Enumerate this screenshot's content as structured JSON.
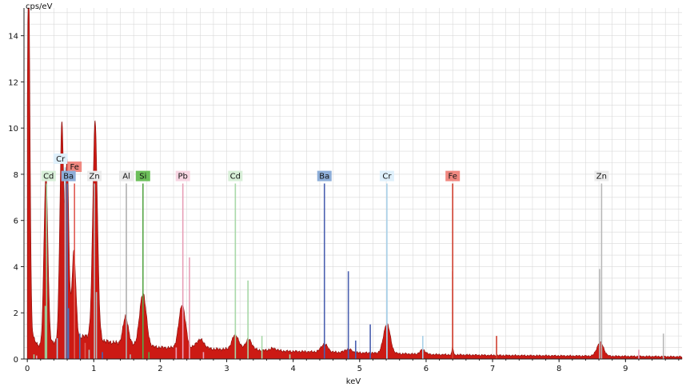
{
  "chart_data": {
    "type": "area",
    "ylabel": "cps/eV",
    "xlabel": "keV",
    "xlim": [
      -0.05,
      9.85
    ],
    "ylim": [
      0,
      15.2
    ],
    "x_ticks": [
      0,
      1,
      2,
      3,
      4,
      5,
      6,
      7,
      8,
      9
    ],
    "y_ticks": [
      0,
      2,
      4,
      6,
      8,
      10,
      12,
      14
    ],
    "grid": true,
    "colors": {
      "spectrum": "#cc1a14",
      "spectrum_edge": "#8a0f0c",
      "grid": "#d9d9d9"
    },
    "spectrum": {
      "background": [
        [
          0.0,
          2.0
        ],
        [
          0.05,
          1.5
        ],
        [
          0.1,
          0.9
        ],
        [
          0.15,
          0.6
        ],
        [
          0.2,
          0.55
        ],
        [
          0.3,
          0.6
        ],
        [
          0.4,
          0.7
        ],
        [
          0.5,
          0.8
        ],
        [
          0.7,
          0.9
        ],
        [
          0.9,
          1.0
        ],
        [
          1.2,
          0.75
        ],
        [
          1.6,
          0.6
        ],
        [
          2.0,
          0.5
        ],
        [
          2.5,
          0.45
        ],
        [
          3.0,
          0.42
        ],
        [
          3.5,
          0.38
        ],
        [
          4.0,
          0.33
        ],
        [
          4.5,
          0.3
        ],
        [
          5.0,
          0.27
        ],
        [
          5.5,
          0.24
        ],
        [
          6.0,
          0.2
        ],
        [
          6.5,
          0.18
        ],
        [
          7.0,
          0.16
        ],
        [
          7.5,
          0.15
        ],
        [
          8.0,
          0.14
        ],
        [
          8.5,
          0.13
        ],
        [
          9.0,
          0.12
        ],
        [
          9.5,
          0.11
        ],
        [
          9.85,
          0.1
        ]
      ],
      "peaks": [
        [
          0.02,
          15.0,
          0.02
        ],
        [
          0.28,
          7.4,
          0.03
        ],
        [
          0.52,
          9.4,
          0.03
        ],
        [
          0.6,
          7.6,
          0.025
        ],
        [
          0.7,
          3.8,
          0.03
        ],
        [
          1.02,
          9.4,
          0.035
        ],
        [
          1.48,
          1.2,
          0.04
        ],
        [
          1.74,
          2.3,
          0.05
        ],
        [
          2.33,
          1.9,
          0.05
        ],
        [
          2.6,
          0.4,
          0.06
        ],
        [
          3.13,
          0.65,
          0.05
        ],
        [
          3.33,
          0.45,
          0.05
        ],
        [
          3.7,
          0.1,
          0.05
        ],
        [
          4.47,
          0.35,
          0.05
        ],
        [
          4.83,
          0.15,
          0.05
        ],
        [
          5.41,
          1.3,
          0.05
        ],
        [
          5.95,
          0.2,
          0.04
        ],
        [
          6.4,
          0.35,
          0.01
        ],
        [
          8.62,
          0.6,
          0.05
        ]
      ]
    },
    "markers": [
      {
        "element": "Cd",
        "x": 0.29,
        "h": 7.6,
        "color": "#9ccf9c"
      },
      {
        "element": "Ba",
        "x": 0.6,
        "h": 7.6,
        "color": "#4a72b8"
      },
      {
        "element": "Fe",
        "x": 0.71,
        "h": 7.6,
        "color": "#e05a52"
      },
      {
        "element": "Zn",
        "x": 1.01,
        "h": 7.6,
        "color": "#b8b8b8"
      },
      {
        "element": "Al",
        "x": 1.49,
        "h": 7.6,
        "color": "#b0b0b0"
      },
      {
        "element": "Si",
        "x": 1.74,
        "h": 7.6,
        "color": "#5aa84a"
      },
      {
        "element": "Pb",
        "x": 2.34,
        "h": 7.6,
        "color": "#e8a0b8"
      },
      {
        "element": "Cd",
        "x": 3.13,
        "h": 7.6,
        "color": "#a8d8a8"
      },
      {
        "element": "Ba",
        "x": 4.47,
        "h": 7.6,
        "color": "#4a60b0"
      },
      {
        "element": "Cr",
        "x": 5.41,
        "h": 7.6,
        "color": "#a8d0e8"
      },
      {
        "element": "Fe",
        "x": 6.4,
        "h": 7.6,
        "color": "#d04030"
      },
      {
        "element": "Zn",
        "x": 8.64,
        "h": 7.6,
        "color": "#b8b8b8"
      },
      {
        "element": "Cr",
        "x": 0.57,
        "h": 8.3,
        "color": "#a8d0e8"
      }
    ],
    "labels": [
      {
        "text": "Cd",
        "x": 0.32,
        "y": 7.7,
        "bg": "#d8efd8"
      },
      {
        "text": "Cr",
        "x": 0.5,
        "y": 8.45,
        "bg": "#dff0fb"
      },
      {
        "text": "Fe",
        "x": 0.71,
        "y": 8.1,
        "bg": "#f08880"
      },
      {
        "text": "Ba",
        "x": 0.62,
        "y": 7.7,
        "bg": "#8eaed8"
      },
      {
        "text": "Zn",
        "x": 1.01,
        "y": 7.7,
        "bg": "#ececec"
      },
      {
        "text": "Al",
        "x": 1.49,
        "y": 7.7,
        "bg": "#e8e8e8"
      },
      {
        "text": "Si",
        "x": 1.74,
        "y": 7.7,
        "bg": "#6cbf5a"
      },
      {
        "text": "Pb",
        "x": 2.34,
        "y": 7.7,
        "bg": "#f7d5e2"
      },
      {
        "text": "Cd",
        "x": 3.13,
        "y": 7.7,
        "bg": "#d8efd8"
      },
      {
        "text": "Ba",
        "x": 4.47,
        "y": 7.7,
        "bg": "#8eaed8"
      },
      {
        "text": "Cr",
        "x": 5.41,
        "y": 7.7,
        "bg": "#dff0fb"
      },
      {
        "text": "Fe",
        "x": 6.4,
        "y": 7.7,
        "bg": "#f08880"
      },
      {
        "text": "Zn",
        "x": 8.64,
        "y": 7.7,
        "bg": "#ececec"
      }
    ],
    "lines": [
      [
        0.1,
        0.2,
        "#9ccf9c"
      ],
      [
        0.14,
        0.15,
        "#e8a0b8"
      ],
      [
        0.27,
        2.3,
        "#9ccf9c"
      ],
      [
        0.45,
        0.9,
        "#a8d0e8"
      ],
      [
        0.62,
        2.2,
        "#4a72b8"
      ],
      [
        0.79,
        1.1,
        "#4a72b8"
      ],
      [
        0.87,
        0.7,
        "#e05a52"
      ],
      [
        0.93,
        0.4,
        "#b8b8b8"
      ],
      [
        1.04,
        2.9,
        "#b8b8b8"
      ],
      [
        1.13,
        0.3,
        "#4a60b0"
      ],
      [
        1.55,
        0.2,
        "#b0b0b0"
      ],
      [
        1.83,
        0.3,
        "#5aa84a"
      ],
      [
        2.24,
        0.5,
        "#e8a0b8"
      ],
      [
        2.44,
        4.4,
        "#e8a0b8"
      ],
      [
        2.65,
        0.3,
        "#e8a0b8"
      ],
      [
        3.32,
        3.4,
        "#a8d8a8"
      ],
      [
        3.53,
        1.0,
        "#a8d8a8"
      ],
      [
        3.95,
        0.2,
        "#a8d8a8"
      ],
      [
        4.83,
        3.8,
        "#4a60b0"
      ],
      [
        4.94,
        0.8,
        "#4a60b0"
      ],
      [
        5.16,
        1.5,
        "#4a60b0"
      ],
      [
        5.41,
        3.8,
        "#a8d0e8"
      ],
      [
        5.95,
        1.0,
        "#a8d0e8"
      ],
      [
        6.4,
        3.8,
        "#d04030"
      ],
      [
        7.06,
        1.0,
        "#d04030"
      ],
      [
        8.61,
        3.9,
        "#b8b8b8"
      ],
      [
        9.2,
        0.4,
        "#e8a0b8"
      ],
      [
        9.57,
        1.1,
        "#b8b8b8"
      ]
    ]
  }
}
